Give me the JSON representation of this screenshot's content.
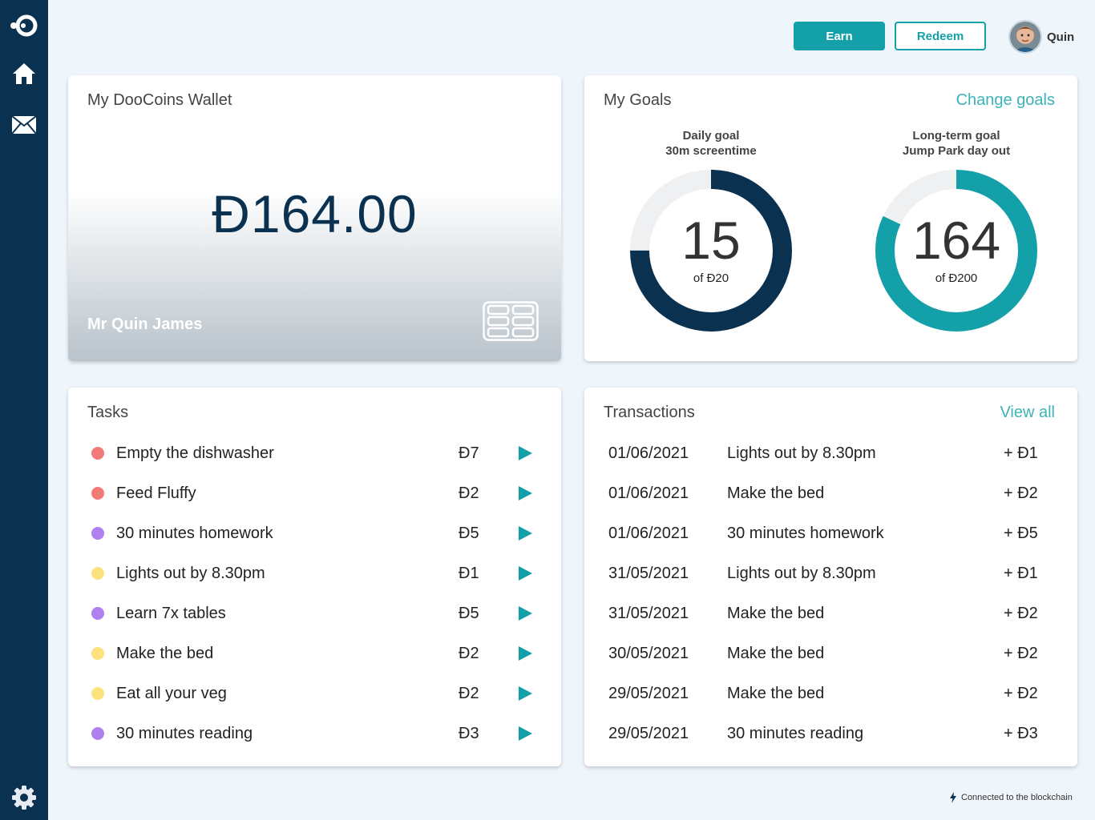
{
  "header": {
    "earn_label": "Earn",
    "redeem_label": "Redeem",
    "user_name": "Quin"
  },
  "wallet": {
    "title": "My DooCoins Wallet",
    "balance": "Đ164.00",
    "owner": "Mr Quin James"
  },
  "goals": {
    "title": "My Goals",
    "change_label": "Change goals",
    "daily": {
      "heading": "Daily goal",
      "name": "30m screentime",
      "value": "15",
      "of_label": "of Đ20",
      "progress": 0.75,
      "color": "#0b3150"
    },
    "longterm": {
      "heading": "Long-term goal",
      "name": "Jump Park day out",
      "value": "164",
      "of_label": "of Đ200",
      "progress": 0.82,
      "color": "#13a0a8"
    }
  },
  "tasks": {
    "title": "Tasks",
    "items": [
      {
        "name": "Empty the dishwasher",
        "reward": "Đ7",
        "color": "#f47a7a"
      },
      {
        "name": "Feed Fluffy",
        "reward": "Đ2",
        "color": "#f47a7a"
      },
      {
        "name": "30 minutes homework",
        "reward": "Đ5",
        "color": "#b07ff0"
      },
      {
        "name": "Lights out by 8.30pm",
        "reward": "Đ1",
        "color": "#fbe27d"
      },
      {
        "name": "Learn 7x tables",
        "reward": "Đ5",
        "color": "#b07ff0"
      },
      {
        "name": "Make the bed",
        "reward": "Đ2",
        "color": "#fbe27d"
      },
      {
        "name": "Eat all your veg",
        "reward": "Đ2",
        "color": "#fbe27d"
      },
      {
        "name": "30 minutes reading",
        "reward": "Đ3",
        "color": "#b07ff0"
      }
    ]
  },
  "transactions": {
    "title": "Transactions",
    "view_all_label": "View all",
    "items": [
      {
        "date": "01/06/2021",
        "description": "Lights out by 8.30pm",
        "amount": "+ Đ1"
      },
      {
        "date": "01/06/2021",
        "description": "Make the bed",
        "amount": "+ Đ2"
      },
      {
        "date": "01/06/2021",
        "description": "30 minutes homework",
        "amount": "+ Đ5"
      },
      {
        "date": "31/05/2021",
        "description": "Lights out by 8.30pm",
        "amount": "+ Đ1"
      },
      {
        "date": "31/05/2021",
        "description": "Make the bed",
        "amount": "+ Đ2"
      },
      {
        "date": "30/05/2021",
        "description": "Make the bed",
        "amount": "+ Đ2"
      },
      {
        "date": "29/05/2021",
        "description": "Make the bed",
        "amount": "+ Đ2"
      },
      {
        "date": "29/05/2021",
        "description": "30 minutes reading",
        "amount": "+ Đ3"
      }
    ]
  },
  "footer": {
    "status": "Connected to the blockchain"
  },
  "colors": {
    "sidebar": "#0b3150",
    "accent": "#13a0a8",
    "link": "#3cb3b9"
  }
}
